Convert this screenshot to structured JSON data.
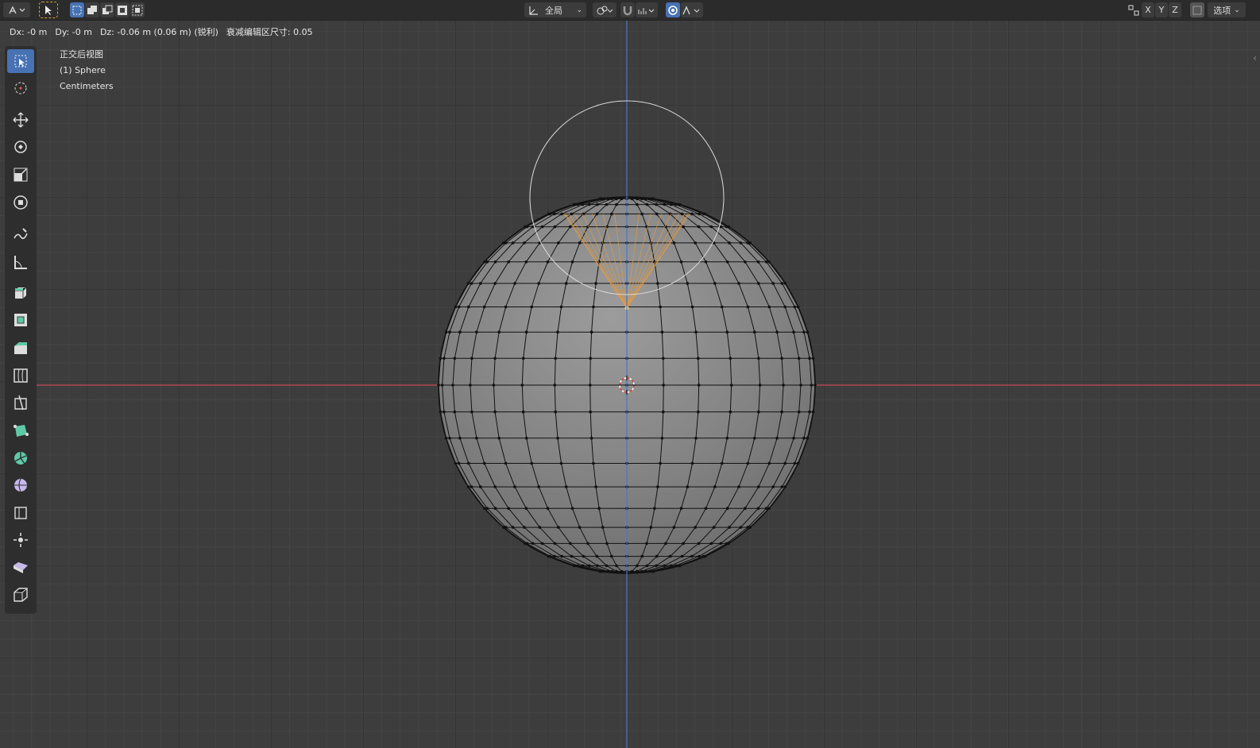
{
  "header": {
    "orientation": "全局",
    "options": "选项",
    "axes": [
      "X",
      "Y",
      "Z"
    ]
  },
  "status": {
    "dx": "Dx: -0 m",
    "dy": "Dy: -0 m",
    "dz": "Dz: -0.06 m (0.06 m) (锐利)",
    "falloff": "衰减编辑区尺寸: 0.05"
  },
  "viewport_info": {
    "view_name": "正交后视图",
    "object": "(1) Sphere",
    "units": "Centimeters"
  },
  "tools": [
    {
      "name": "select-box-icon",
      "active": true
    },
    {
      "name": "cursor-icon",
      "active": false
    },
    {
      "name": "move-icon",
      "active": false
    },
    {
      "name": "rotate-icon",
      "active": false
    },
    {
      "name": "scale-icon",
      "active": false
    },
    {
      "name": "transform-icon",
      "active": false
    },
    {
      "name": "annotate-icon",
      "active": false
    },
    {
      "name": "measure-icon",
      "active": false
    },
    {
      "name": "extrude-region-icon",
      "active": false
    },
    {
      "name": "inset-faces-icon",
      "active": false
    },
    {
      "name": "bevel-icon",
      "active": false
    },
    {
      "name": "loop-cut-icon",
      "active": false
    },
    {
      "name": "knife-icon",
      "active": false
    },
    {
      "name": "poly-build-icon",
      "active": false
    },
    {
      "name": "spin-icon",
      "active": false
    },
    {
      "name": "smooth-icon",
      "active": false
    },
    {
      "name": "edge-slide-icon",
      "active": false
    },
    {
      "name": "shrink-fatten-icon",
      "active": false
    },
    {
      "name": "shear-icon",
      "active": false
    },
    {
      "name": "rip-region-icon",
      "active": false
    }
  ],
  "colors": {
    "x_axis": "#c24a5a",
    "z_axis": "#4a78c4",
    "accent": "#4772b3",
    "selected_vertex": "#e89a3c",
    "mesh_face": "#8a8a8a",
    "mesh_wire": "#111111"
  }
}
